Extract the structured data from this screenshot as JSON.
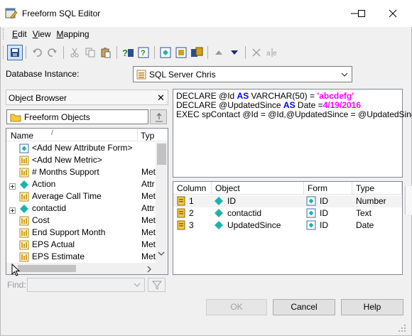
{
  "window": {
    "title": "Freeform SQL Editor"
  },
  "menu": {
    "items": [
      "Edit",
      "View",
      "Mapping"
    ],
    "underline": [
      "E",
      "V",
      "M"
    ]
  },
  "database_instance": {
    "label": "Database Instance:",
    "value": "SQL Server Chris"
  },
  "object_browser": {
    "title": "Object Browser",
    "folder": "Freeform Objects",
    "columns": [
      "Name",
      "Typ"
    ],
    "rows": [
      {
        "name": "<Add New Attribute Form>",
        "type": "",
        "icon": "attribute-form-icon",
        "expand": false
      },
      {
        "name": "<Add New Metric>",
        "type": "",
        "icon": "metric-icon",
        "expand": false
      },
      {
        "name": "# Months Support",
        "type": "Met",
        "icon": "metric-icon",
        "expand": false
      },
      {
        "name": "Action",
        "type": "Attr",
        "icon": "attribute-icon",
        "expand": true
      },
      {
        "name": "Average Call Time",
        "type": "Met",
        "icon": "metric-icon",
        "expand": false
      },
      {
        "name": "contactid",
        "type": "Attr",
        "icon": "attribute-icon",
        "expand": true
      },
      {
        "name": "Cost",
        "type": "Met",
        "icon": "metric-icon",
        "expand": false
      },
      {
        "name": "End Support Month",
        "type": "Met",
        "icon": "metric-icon",
        "expand": false
      },
      {
        "name": "EPS Actual",
        "type": "Met",
        "icon": "metric-icon",
        "expand": false
      },
      {
        "name": "EPS Estimate",
        "type": "Met",
        "icon": "metric-icon",
        "expand": false
      }
    ],
    "find_label": "Find:"
  },
  "sql": {
    "line1": {
      "a": "DECLARE @Id ",
      "kw": "AS",
      "b": " VARCHAR(50) = ",
      "str": "'abcdefg'"
    },
    "line2": {
      "a": "DECLARE @UpdatedSince ",
      "kw": "AS",
      "b": " Date =",
      "str": "4/19/2016"
    },
    "line3": "EXEC spContact @Id = @Id,@UpdatedSince = @UpdatedSince;"
  },
  "mapping_table": {
    "headers": [
      "Column",
      "Object",
      "Form",
      "Type"
    ],
    "rows": [
      {
        "column": "1",
        "object": "ID",
        "form": "ID",
        "type": "Number"
      },
      {
        "column": "2",
        "object": "contactid",
        "form": "ID",
        "type": "Text"
      },
      {
        "column": "3",
        "object": "UpdatedSince",
        "form": "ID",
        "type": "Date"
      }
    ]
  },
  "buttons": {
    "ok": "OK",
    "cancel": "Cancel",
    "help": "Help"
  },
  "colors": {
    "keyword": "#0000ff",
    "string": "#ff00ff",
    "attribute": "#20b2aa",
    "metric": "#d4a017"
  }
}
